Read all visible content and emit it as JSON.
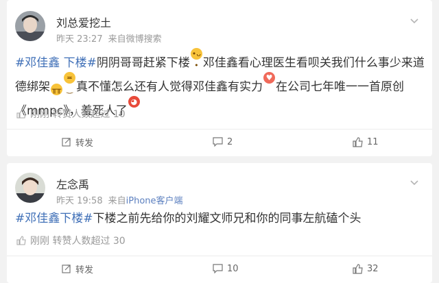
{
  "posts": [
    {
      "author": "刘总爱挖土",
      "time": "昨天 23:27",
      "source_prefix": "来自",
      "source": "微博搜索",
      "content": {
        "tag": "#邓佳鑫 下楼#",
        "seg1": "阴阴哥哥赶紧下楼",
        "seg2": "邓佳鑫看心理医生看呗关我们什么事少来道德绑架",
        "seg3": "真不懂怎么还有人觉得邓佳鑫有实力",
        "seg4": "在公司七年唯一一首原创《mmpc》，羞死人了"
      },
      "emojis": [
        "tongue-face-emoji",
        "crying-face-emoji",
        "grimace-face-emoji",
        "heart-eyes-emoji",
        "shy-face-emoji"
      ],
      "repost_info": "刚刚 转赞人数超过 10",
      "actions": {
        "repost": "转发",
        "comments": "2",
        "likes": "11"
      }
    },
    {
      "author": "左念禹",
      "time": "昨天 19:58",
      "source_prefix": "来自",
      "source": "iPhone客户端",
      "content": {
        "tag": "#邓佳鑫下楼#",
        "seg1": "下楼之前先给你的刘耀文师兄和你的同事左航磕个头"
      },
      "repost_info": "刚刚 转赞人数超过 30",
      "actions": {
        "repost": "转发",
        "comments": "10",
        "likes": "32"
      }
    }
  ],
  "colors": {
    "tag": "#3f6fb7",
    "meta": "#999999",
    "source": "#5b7fbf",
    "background": "#f2f2f2"
  }
}
